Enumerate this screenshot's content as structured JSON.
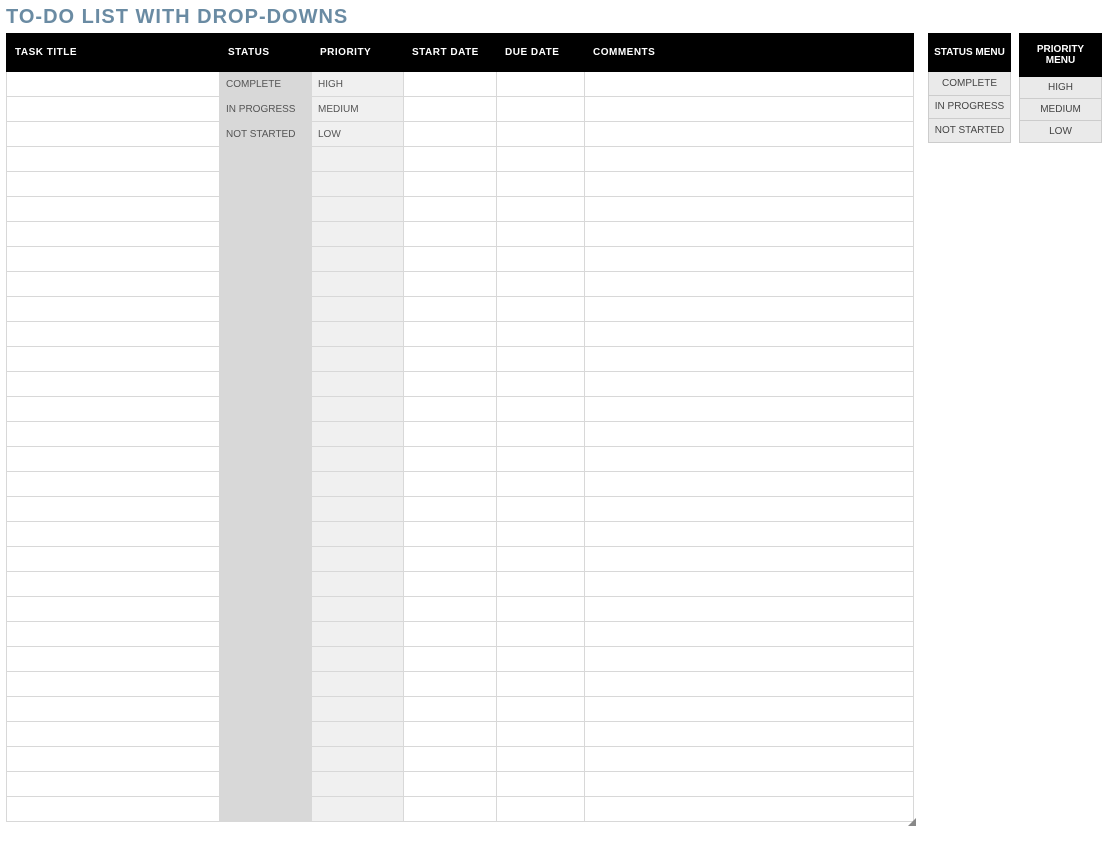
{
  "title": "TO-DO LIST WITH DROP-DOWNS",
  "main": {
    "headers": {
      "task": "TASK TITLE",
      "status": "STATUS",
      "priority": "PRIORITY",
      "start": "START DATE",
      "due": "DUE DATE",
      "comments": "COMMENTS"
    },
    "rows": [
      {
        "task": "",
        "status": "COMPLETE",
        "priority": "HIGH",
        "start": "",
        "due": "",
        "comments": ""
      },
      {
        "task": "",
        "status": "IN PROGRESS",
        "priority": "MEDIUM",
        "start": "",
        "due": "",
        "comments": ""
      },
      {
        "task": "",
        "status": "NOT STARTED",
        "priority": "LOW",
        "start": "",
        "due": "",
        "comments": ""
      },
      {
        "task": "",
        "status": "",
        "priority": "",
        "start": "",
        "due": "",
        "comments": ""
      },
      {
        "task": "",
        "status": "",
        "priority": "",
        "start": "",
        "due": "",
        "comments": ""
      },
      {
        "task": "",
        "status": "",
        "priority": "",
        "start": "",
        "due": "",
        "comments": ""
      },
      {
        "task": "",
        "status": "",
        "priority": "",
        "start": "",
        "due": "",
        "comments": ""
      },
      {
        "task": "",
        "status": "",
        "priority": "",
        "start": "",
        "due": "",
        "comments": ""
      },
      {
        "task": "",
        "status": "",
        "priority": "",
        "start": "",
        "due": "",
        "comments": ""
      },
      {
        "task": "",
        "status": "",
        "priority": "",
        "start": "",
        "due": "",
        "comments": ""
      },
      {
        "task": "",
        "status": "",
        "priority": "",
        "start": "",
        "due": "",
        "comments": ""
      },
      {
        "task": "",
        "status": "",
        "priority": "",
        "start": "",
        "due": "",
        "comments": ""
      },
      {
        "task": "",
        "status": "",
        "priority": "",
        "start": "",
        "due": "",
        "comments": ""
      },
      {
        "task": "",
        "status": "",
        "priority": "",
        "start": "",
        "due": "",
        "comments": ""
      },
      {
        "task": "",
        "status": "",
        "priority": "",
        "start": "",
        "due": "",
        "comments": ""
      },
      {
        "task": "",
        "status": "",
        "priority": "",
        "start": "",
        "due": "",
        "comments": ""
      },
      {
        "task": "",
        "status": "",
        "priority": "",
        "start": "",
        "due": "",
        "comments": ""
      },
      {
        "task": "",
        "status": "",
        "priority": "",
        "start": "",
        "due": "",
        "comments": ""
      },
      {
        "task": "",
        "status": "",
        "priority": "",
        "start": "",
        "due": "",
        "comments": ""
      },
      {
        "task": "",
        "status": "",
        "priority": "",
        "start": "",
        "due": "",
        "comments": ""
      },
      {
        "task": "",
        "status": "",
        "priority": "",
        "start": "",
        "due": "",
        "comments": ""
      },
      {
        "task": "",
        "status": "",
        "priority": "",
        "start": "",
        "due": "",
        "comments": ""
      },
      {
        "task": "",
        "status": "",
        "priority": "",
        "start": "",
        "due": "",
        "comments": ""
      },
      {
        "task": "",
        "status": "",
        "priority": "",
        "start": "",
        "due": "",
        "comments": ""
      },
      {
        "task": "",
        "status": "",
        "priority": "",
        "start": "",
        "due": "",
        "comments": ""
      },
      {
        "task": "",
        "status": "",
        "priority": "",
        "start": "",
        "due": "",
        "comments": ""
      },
      {
        "task": "",
        "status": "",
        "priority": "",
        "start": "",
        "due": "",
        "comments": ""
      },
      {
        "task": "",
        "status": "",
        "priority": "",
        "start": "",
        "due": "",
        "comments": ""
      },
      {
        "task": "",
        "status": "",
        "priority": "",
        "start": "",
        "due": "",
        "comments": ""
      },
      {
        "task": "",
        "status": "",
        "priority": "",
        "start": "",
        "due": "",
        "comments": ""
      }
    ]
  },
  "status_menu": {
    "header": "STATUS MENU",
    "items": [
      "COMPLETE",
      "IN PROGRESS",
      "NOT STARTED"
    ]
  },
  "priority_menu": {
    "header": "PRIORITY MENU",
    "items": [
      "HIGH",
      "MEDIUM",
      "LOW"
    ]
  }
}
